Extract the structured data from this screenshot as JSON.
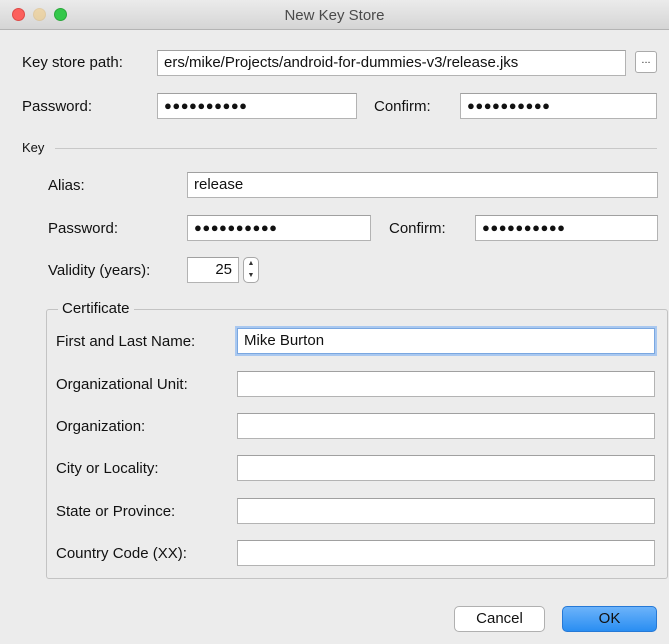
{
  "window": {
    "title": "New Key Store"
  },
  "keystore": {
    "path_label": "Key store path:",
    "path_value": "ers/mike/Projects/android-for-dummies-v3/release.jks",
    "browse_label": "...",
    "password_label": "Password:",
    "password_value": "●●●●●●●●●●",
    "confirm_label": "Confirm:",
    "confirm_value": "●●●●●●●●●●"
  },
  "key": {
    "section_label": "Key",
    "alias_label": "Alias:",
    "alias_value": "release",
    "password_label": "Password:",
    "password_value": "●●●●●●●●●●",
    "confirm_label": "Confirm:",
    "confirm_value": "●●●●●●●●●●",
    "validity_label": "Validity (years):",
    "validity_value": "25",
    "spinner_up": "▲",
    "spinner_down": "▼"
  },
  "certificate": {
    "group_label": "Certificate",
    "first_last_label": "First and Last Name:",
    "first_last_value": "Mike Burton",
    "org_unit_label": "Organizational Unit:",
    "org_unit_value": "",
    "organization_label": "Organization:",
    "organization_value": "",
    "city_label": "City or Locality:",
    "city_value": "",
    "state_label": "State or Province:",
    "state_value": "",
    "country_label": "Country Code (XX):",
    "country_value": ""
  },
  "buttons": {
    "cancel": "Cancel",
    "ok": "OK"
  }
}
